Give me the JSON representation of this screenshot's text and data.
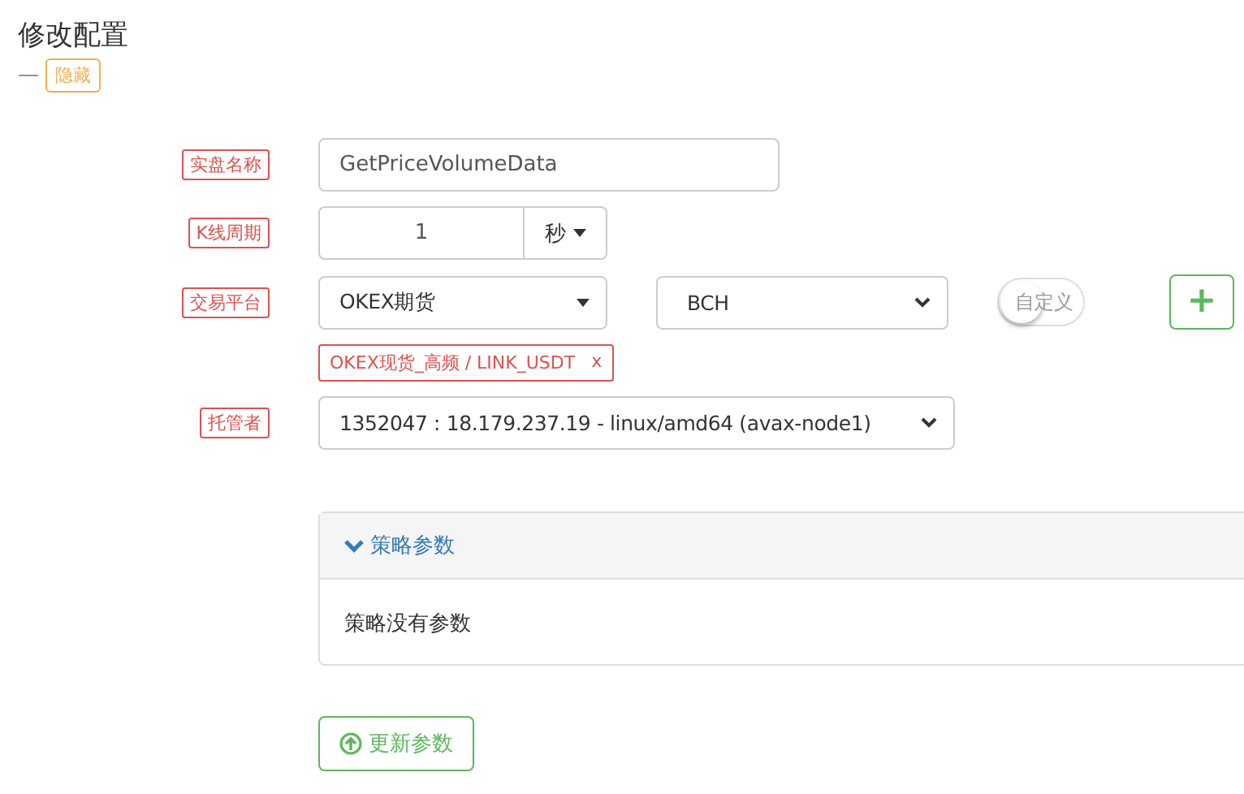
{
  "title": "修改配置",
  "hide_toggle": {
    "dash": "—",
    "label": "隐藏"
  },
  "fields": [
    {
      "kind": "text",
      "label": "实盘名称",
      "value": "GetPriceVolumeData"
    },
    {
      "kind": "period",
      "label": "K线周期",
      "value": "1",
      "unit": "秒"
    },
    {
      "kind": "exchange",
      "label": "交易平台",
      "exchange": "OKEX期货",
      "symbol": "BCH",
      "custom": {
        "label": "自定义",
        "on": false
      },
      "add": "+",
      "tags": [
        {
          "text": "OKEX现货_高频 / LINK_USDT",
          "remove": "x"
        }
      ]
    },
    {
      "kind": "select",
      "label": "托管者",
      "value": "1352047 : 18.179.237.19 - linux/amd64 (avax-node1)"
    }
  ],
  "panel": {
    "title": "策略参数",
    "expanded": true,
    "body": "策略没有参数"
  },
  "update_button": "更新参数"
}
